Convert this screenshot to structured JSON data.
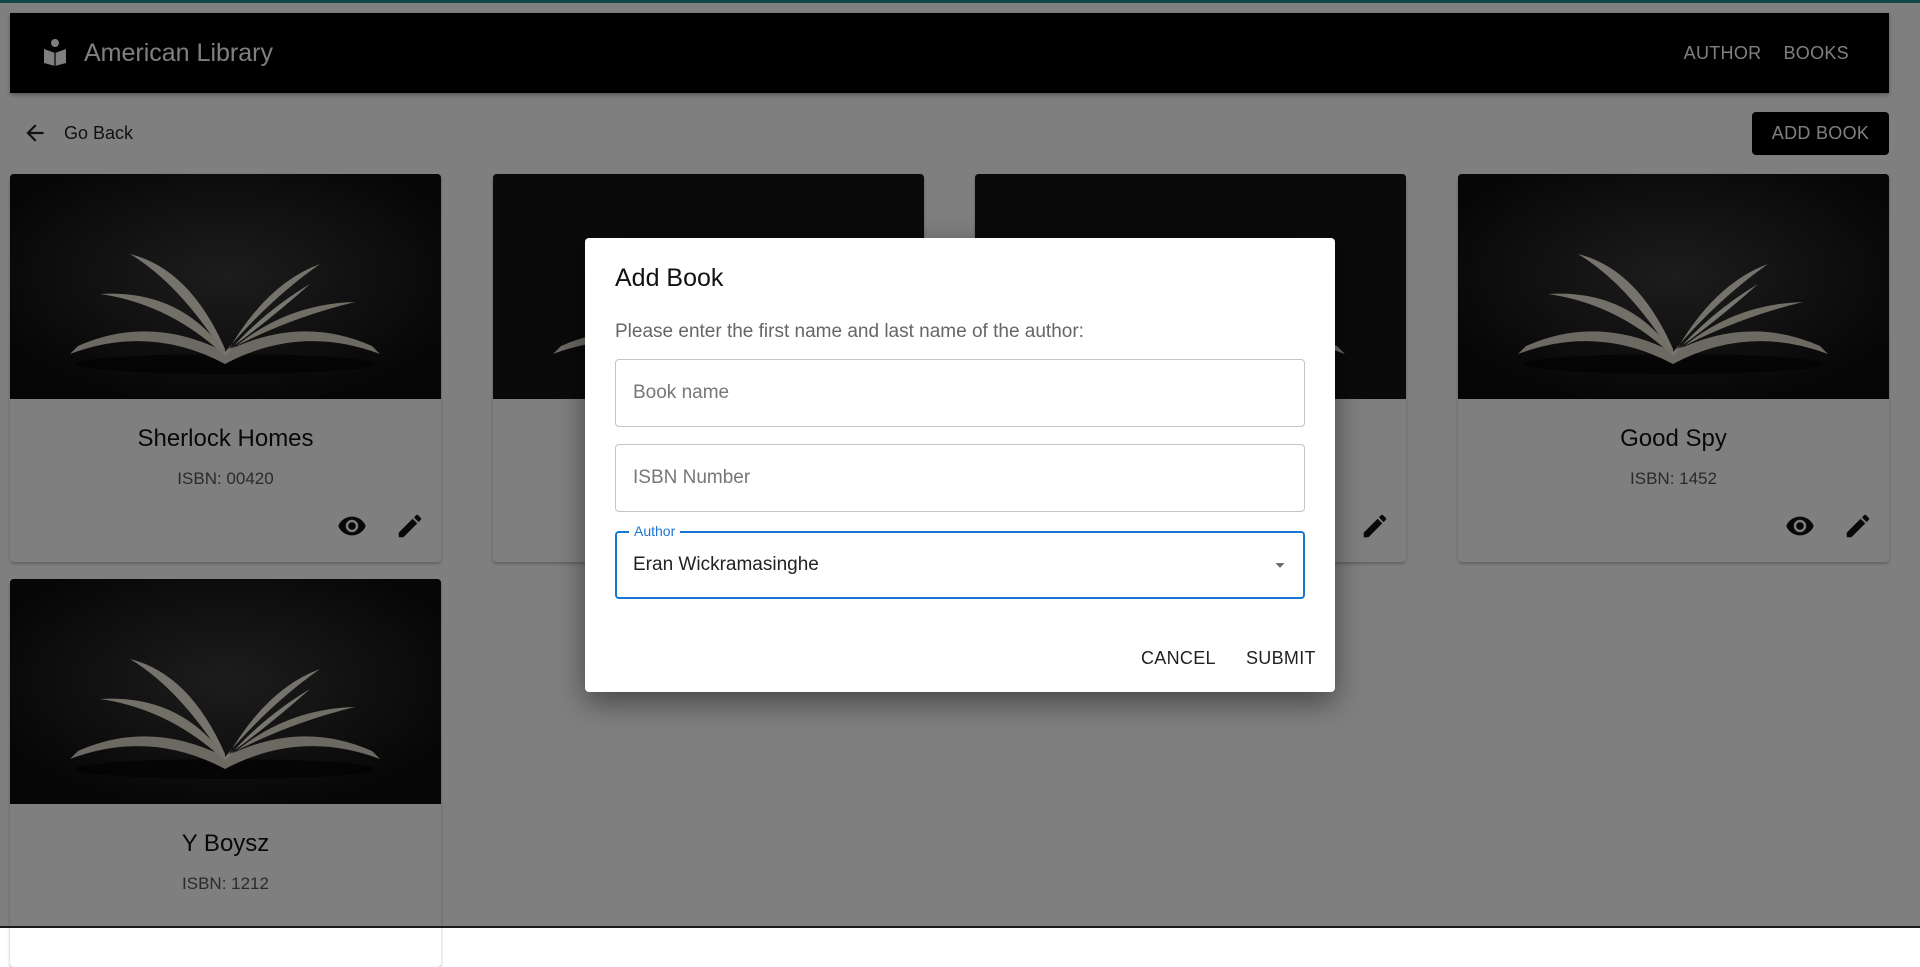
{
  "app": {
    "title": "American Library",
    "nav": [
      "AUTHOR",
      "BOOKS"
    ]
  },
  "toolbar": {
    "go_back_label": "Go Back",
    "add_book_label": "ADD BOOK"
  },
  "books": [
    {
      "title": "Sherlock Homes",
      "isbn": "ISBN: 00420"
    },
    {
      "title": "",
      "isbn": ""
    },
    {
      "title": "",
      "isbn": ""
    },
    {
      "title": "Good Spy",
      "isbn": "ISBN: 1452"
    },
    {
      "title": "Y Boysz",
      "isbn": "ISBN: 1212"
    }
  ],
  "dialog": {
    "title": "Add Book",
    "description": "Please enter the first name and last name of the author:",
    "book_name_placeholder": "Book name",
    "isbn_placeholder": "ISBN Number",
    "author_label": "Author",
    "author_value": "Eran Wickramasinghe",
    "cancel_label": "CANCEL",
    "submit_label": "SUBMIT"
  },
  "colors": {
    "appbar": "#000000",
    "accent": "#1976d2",
    "top_line": "#1f8f8c"
  }
}
